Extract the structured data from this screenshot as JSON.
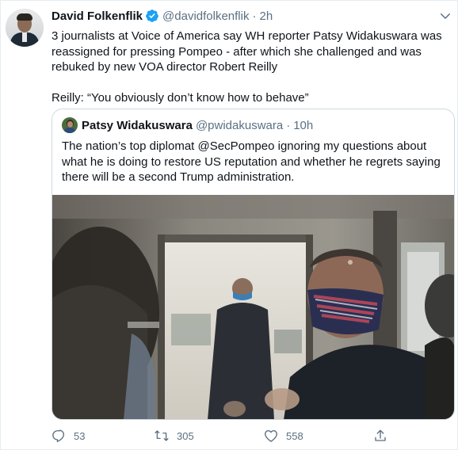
{
  "author": {
    "name": "David Folkenflik",
    "handle": "@davidfolkenflik",
    "separator": "·",
    "time": "2h",
    "verified": true
  },
  "tweet": {
    "paragraph1": "3 journalists at Voice of America say WH reporter Patsy Widakuswara was reassigned for pressing Pompeo - after which she challenged and was rebuked by new VOA director Robert Reilly",
    "paragraph2": "Reilly: “You obviously don’t know how to behave”"
  },
  "quoted": {
    "name": "Patsy Widakuswara",
    "handle": "@pwidakuswara",
    "separator": "·",
    "time": "10h",
    "text": "The nation’s top diplomat @SecPompeo ignoring my questions about what he is doing to restore US reputation and whether he regrets saying there will be a second Trump administration."
  },
  "actions": {
    "replies": "53",
    "retweets": "305",
    "likes": "558"
  },
  "icons": {
    "verified": "verified-badge-icon",
    "more": "more-chevron-icon",
    "reply": "reply-icon",
    "retweet": "retweet-icon",
    "like": "heart-icon",
    "share": "share-icon"
  },
  "colors": {
    "accent": "#1da1f2",
    "secondary_text": "#5b7083",
    "border": "#cfd9de"
  }
}
